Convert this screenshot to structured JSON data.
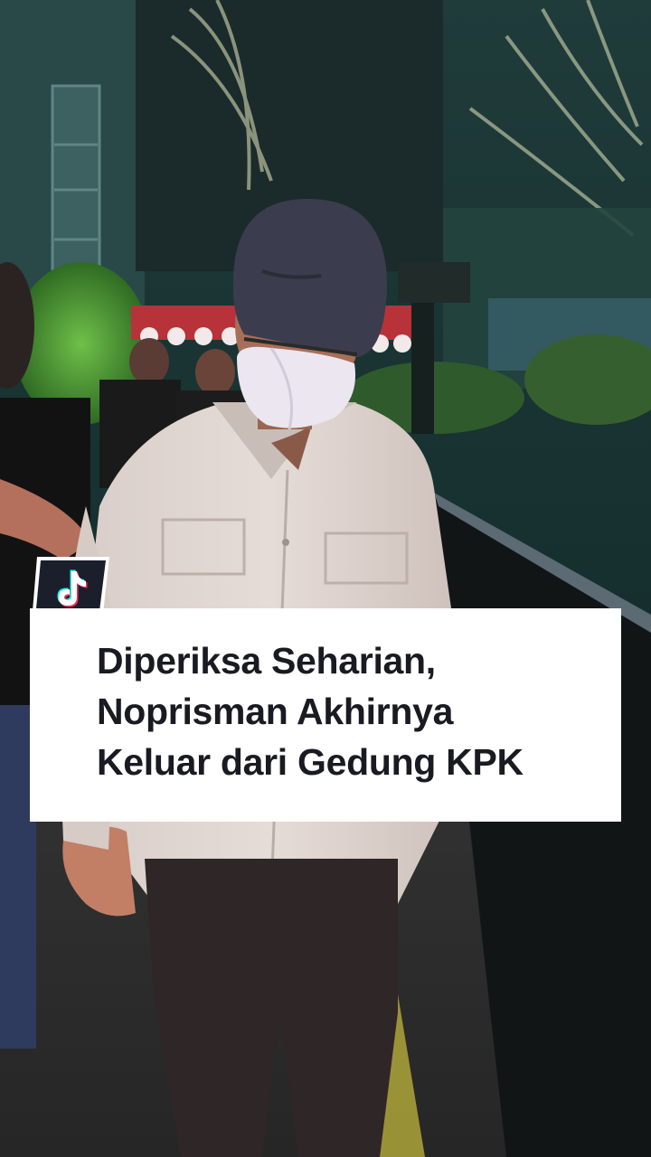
{
  "caption": {
    "lines": [
      "Diperiksa Seharian,",
      "Noprisman Akhirnya",
      "Keluar dari Gedung KPK"
    ]
  },
  "badge": {
    "icon": "tiktok-logo-icon"
  },
  "colors": {
    "caption_background": "#ffffff",
    "caption_text": "#1a1a22",
    "badge_background": "#1b1f2b",
    "badge_border": "#ffffff"
  }
}
